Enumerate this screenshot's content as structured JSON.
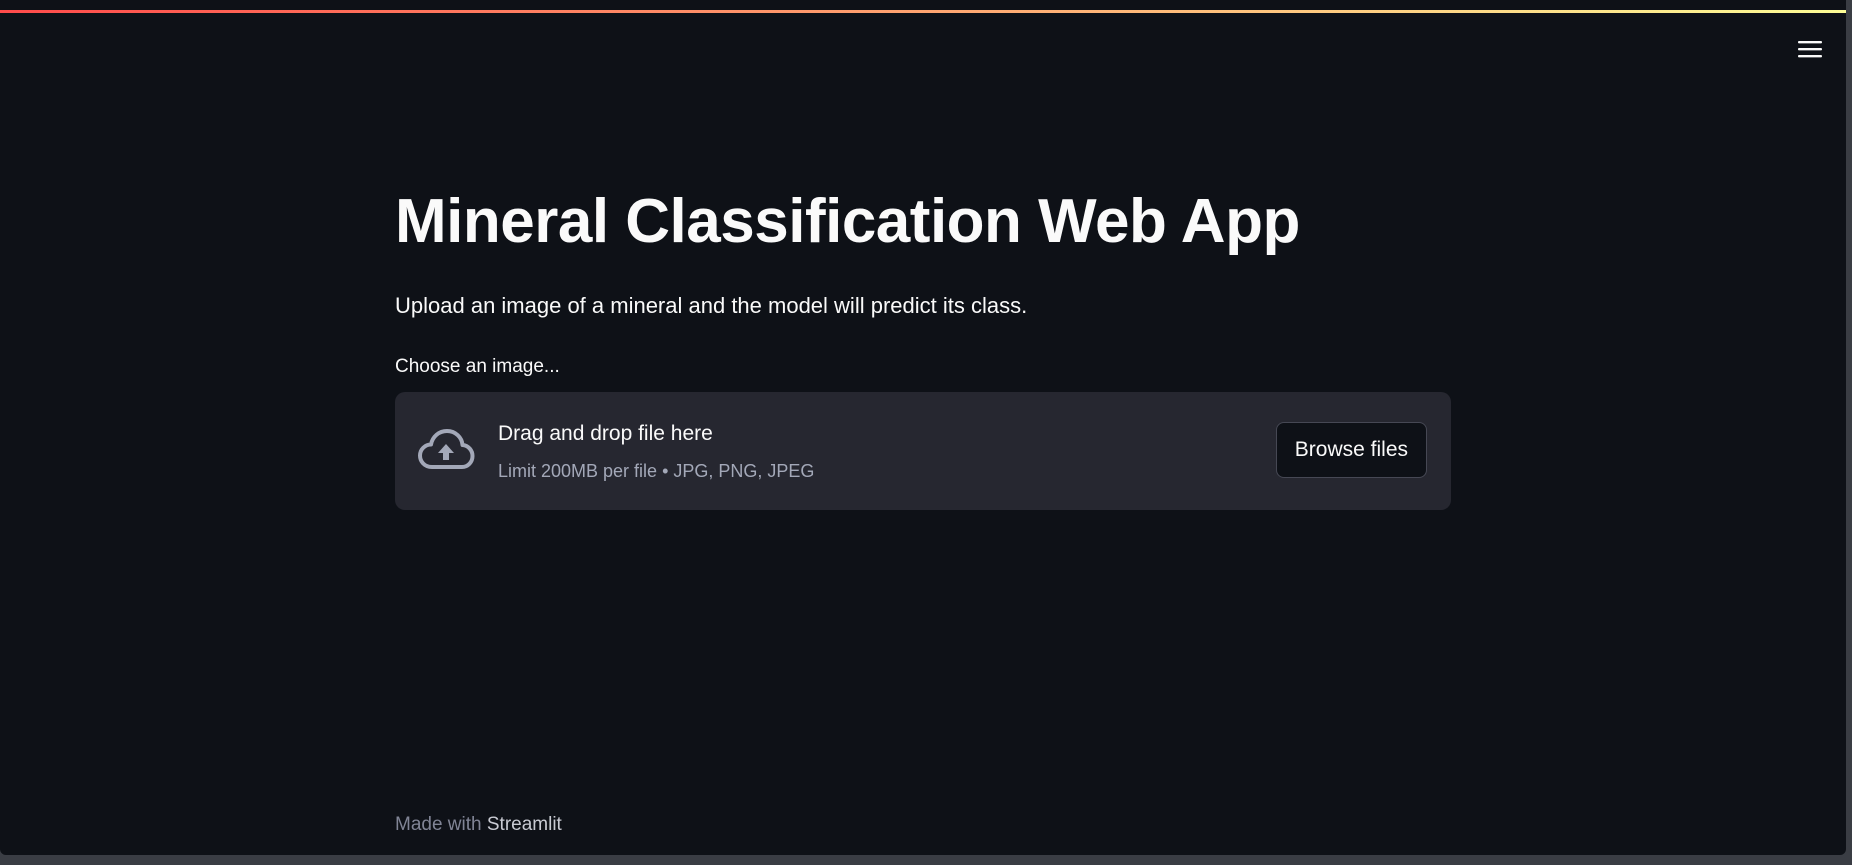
{
  "header": {
    "menu_icon": "hamburger-menu-icon",
    "decoration_colors": [
      "#ff4b4b",
      "#fdfd96"
    ]
  },
  "main": {
    "title": "Mineral Classification Web App",
    "subtitle": "Upload an image of a mineral and the model will predict its class.",
    "uploader": {
      "label": "Choose an image...",
      "icon": "cloud-upload-icon",
      "drop_title": "Drag and drop file here",
      "drop_limit": "Limit 200MB per file • JPG, PNG, JPEG",
      "browse_label": "Browse files"
    }
  },
  "footer": {
    "prefix": "Made with ",
    "brand": "Streamlit"
  },
  "colors": {
    "background": "#0e1117",
    "dropzone": "#262730",
    "text": "#fafafa",
    "muted_text": "#a3a8b8"
  }
}
